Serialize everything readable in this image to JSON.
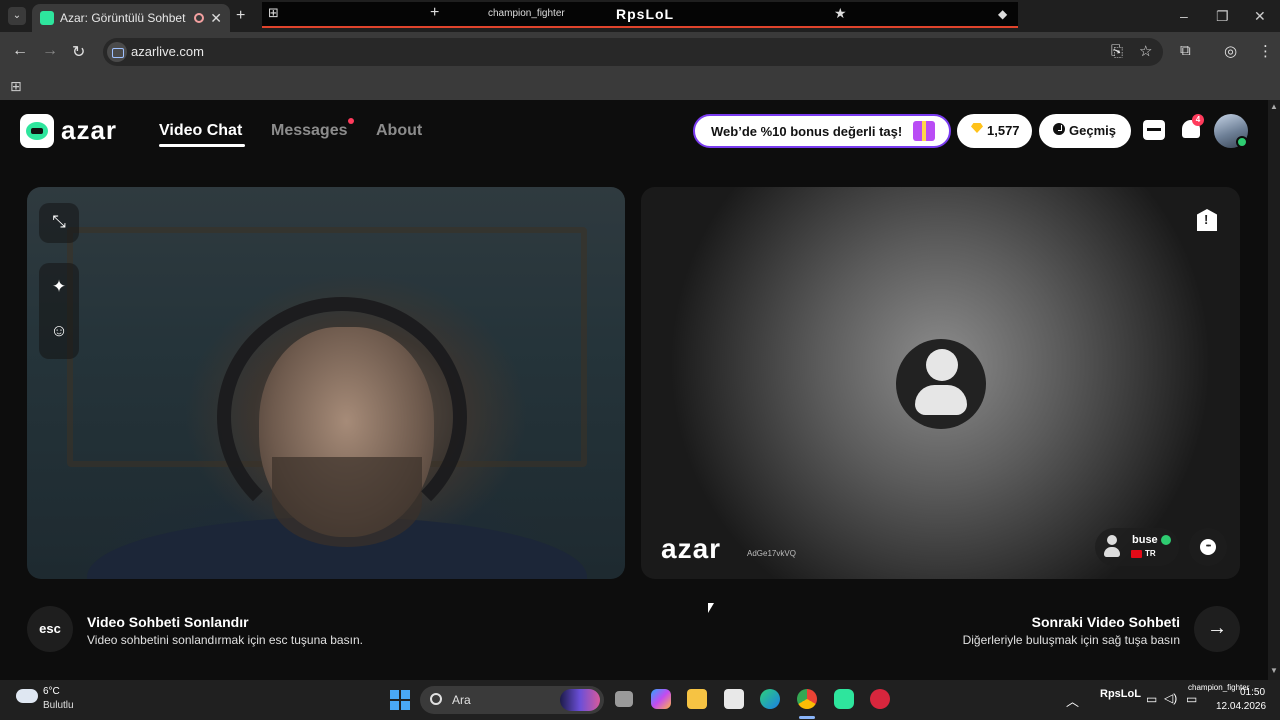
{
  "browser": {
    "tab_title": "Azar: Görüntülü Sohbet & V",
    "new_tab_icon": "plus-icon",
    "url": "azarlive.com",
    "stream_strip": {
      "plus_label": "+",
      "channel": "champion_fighter",
      "logo": "RpsLoL"
    },
    "window_controls": [
      "–",
      "❐",
      "✕"
    ]
  },
  "site": {
    "logo_text": "azar",
    "nav": [
      "Video Chat",
      "Messages",
      "About"
    ],
    "promo_text": "Web’de %10 bonus değerli taş!",
    "gems_count": "1,577",
    "history_label": "Geçmiş",
    "notification_count": "4",
    "colors": {
      "brand_green": "#2ee59d",
      "promo_border": "#7a3cf0",
      "alert": "#ff3b5c"
    }
  },
  "video": {
    "watermark": "azar",
    "peer_id": "AdGe17vkVQ",
    "peer_name": "buse",
    "peer_country": "TR"
  },
  "controls": {
    "esc_key": "esc",
    "end_title": "Video Sohbeti Sonlandır",
    "end_sub": "Video sohbetini sonlandırmak için esc tuşuna basın.",
    "next_title": "Sonraki Video Sohbeti",
    "next_sub": "Diğerleriyle buluşmak için sağ tuşa basın",
    "next_arrow": "→"
  },
  "taskbar": {
    "temperature": "6°C",
    "weather": "Bulutlu",
    "search_placeholder": "Ara",
    "tray_logo": "RpsLoL",
    "tray_channel": "champion_fighter",
    "time": "01:50",
    "date": "12.04.2026"
  }
}
